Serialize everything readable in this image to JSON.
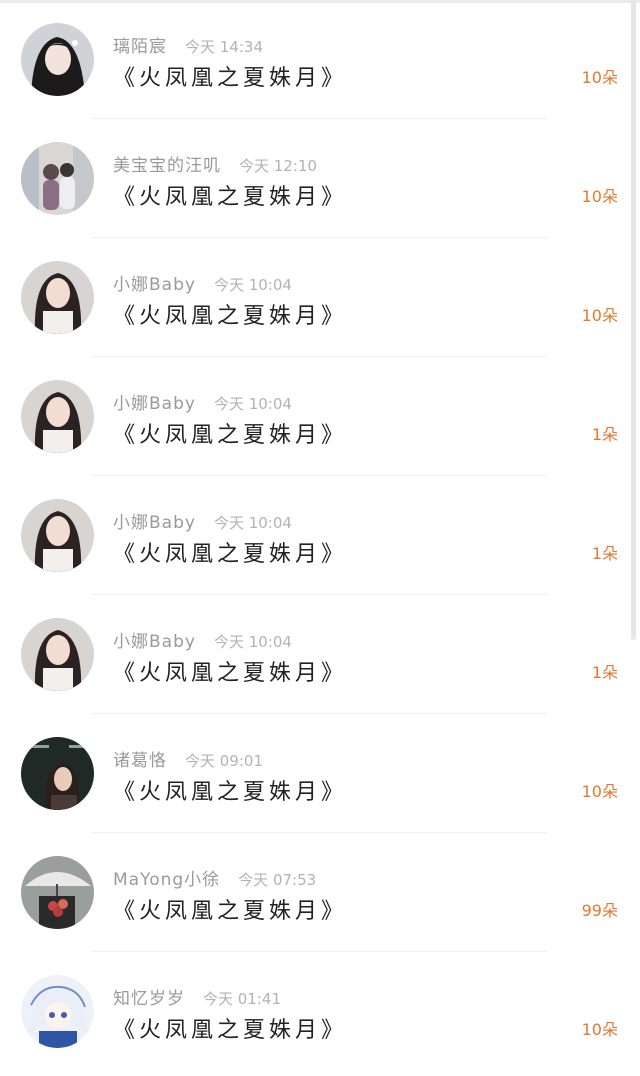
{
  "items": [
    {
      "name": "璃陌宸",
      "time": "今天 14:34",
      "title": "《火凤凰之夏姝月》",
      "count": "10朵",
      "avatar": "portrait-girl-dark-icon"
    },
    {
      "name": "美宝宝的汪叽",
      "time": "今天 12:10",
      "title": "《火凤凰之夏姝月》",
      "count": "10朵",
      "avatar": "couple-scene-icon"
    },
    {
      "name": "小娜Baby",
      "time": "今天 10:04",
      "title": "《火凤凰之夏姝月》",
      "count": "10朵",
      "avatar": "portrait-girl-long-hair-icon"
    },
    {
      "name": "小娜Baby",
      "time": "今天 10:04",
      "title": "《火凤凰之夏姝月》",
      "count": "1朵",
      "avatar": "portrait-girl-long-hair-icon"
    },
    {
      "name": "小娜Baby",
      "time": "今天 10:04",
      "title": "《火凤凰之夏姝月》",
      "count": "1朵",
      "avatar": "portrait-girl-long-hair-icon"
    },
    {
      "name": "小娜Baby",
      "time": "今天 10:04",
      "title": "《火凤凰之夏姝月》",
      "count": "1朵",
      "avatar": "portrait-girl-long-hair-icon"
    },
    {
      "name": "诸葛恪",
      "time": "今天 09:01",
      "title": "《火凤凰之夏姝月》",
      "count": "10朵",
      "avatar": "poster-girl-dark-icon"
    },
    {
      "name": "MaYong小徐",
      "time": "今天 07:53",
      "title": "《火凤凰之夏姝月》",
      "count": "99朵",
      "avatar": "umbrella-bouquet-icon"
    },
    {
      "name": "知忆岁岁",
      "time": "今天 01:41",
      "title": "《火凤凰之夏姝月》",
      "count": "10朵",
      "avatar": "anime-girl-icon"
    }
  ],
  "colors": {
    "count": "#e07a30",
    "name": "#9a9a9a",
    "title": "#222222"
  }
}
